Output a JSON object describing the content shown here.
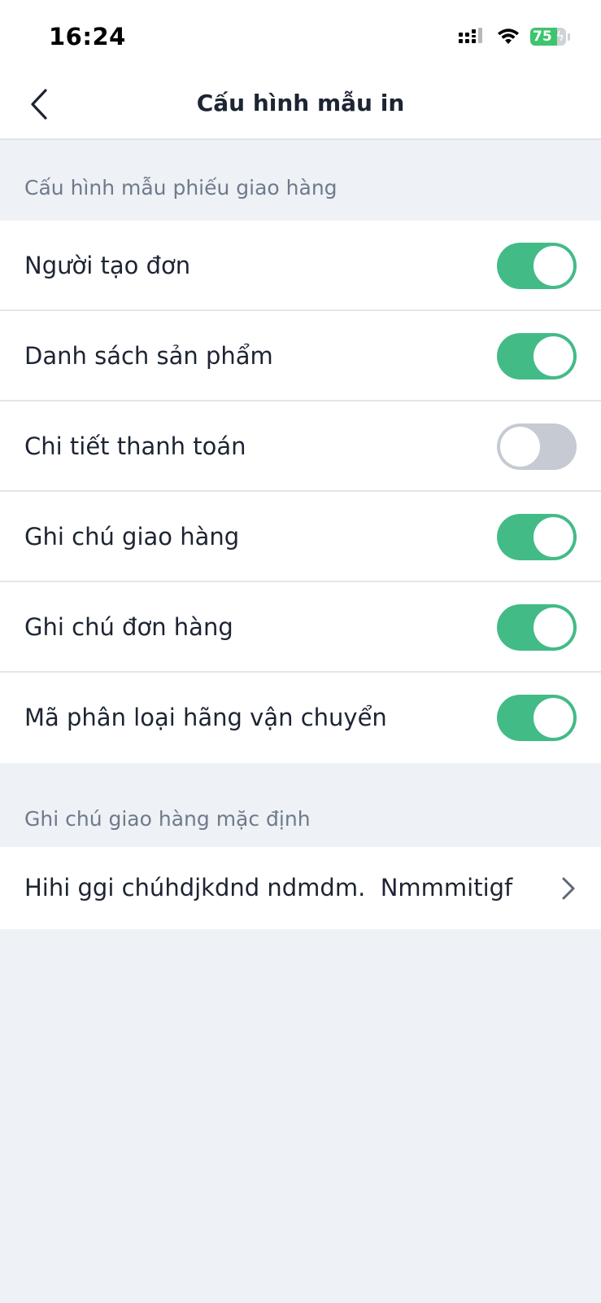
{
  "status_bar": {
    "time": "16:24",
    "battery_level": 75,
    "battery_text": "75",
    "icons": [
      "cellular-signal-icon",
      "wifi-icon",
      "battery-charging-icon"
    ]
  },
  "header": {
    "title": "Cấu hình mẫu in",
    "back_icon": "chevron-left-icon"
  },
  "delivery_section": {
    "title": "Cấu hình mẫu phiếu giao hàng",
    "items": [
      {
        "label": "Người tạo đơn",
        "enabled": true
      },
      {
        "label": "Danh sách sản phẩm",
        "enabled": true
      },
      {
        "label": "Chi tiết thanh toán",
        "enabled": false
      },
      {
        "label": "Ghi chú giao hàng",
        "enabled": true
      },
      {
        "label": "Ghi chú đơn hàng",
        "enabled": true
      },
      {
        "label": "Mã phân loại hãng vận chuyển",
        "enabled": true
      }
    ]
  },
  "default_note_section": {
    "title": "Ghi chú giao hàng mặc định",
    "value": "Hihi ggi chúhdjkdnd ndmdm.  Nmmmitigf",
    "icon": "chevron-right-icon"
  },
  "colors": {
    "toggle_on": "#43bb86",
    "toggle_off": "#c5cad3",
    "background": "#eef1f5",
    "section_label": "#6f7a8c",
    "text": "#1d2433",
    "battery": "#3ec46d"
  }
}
